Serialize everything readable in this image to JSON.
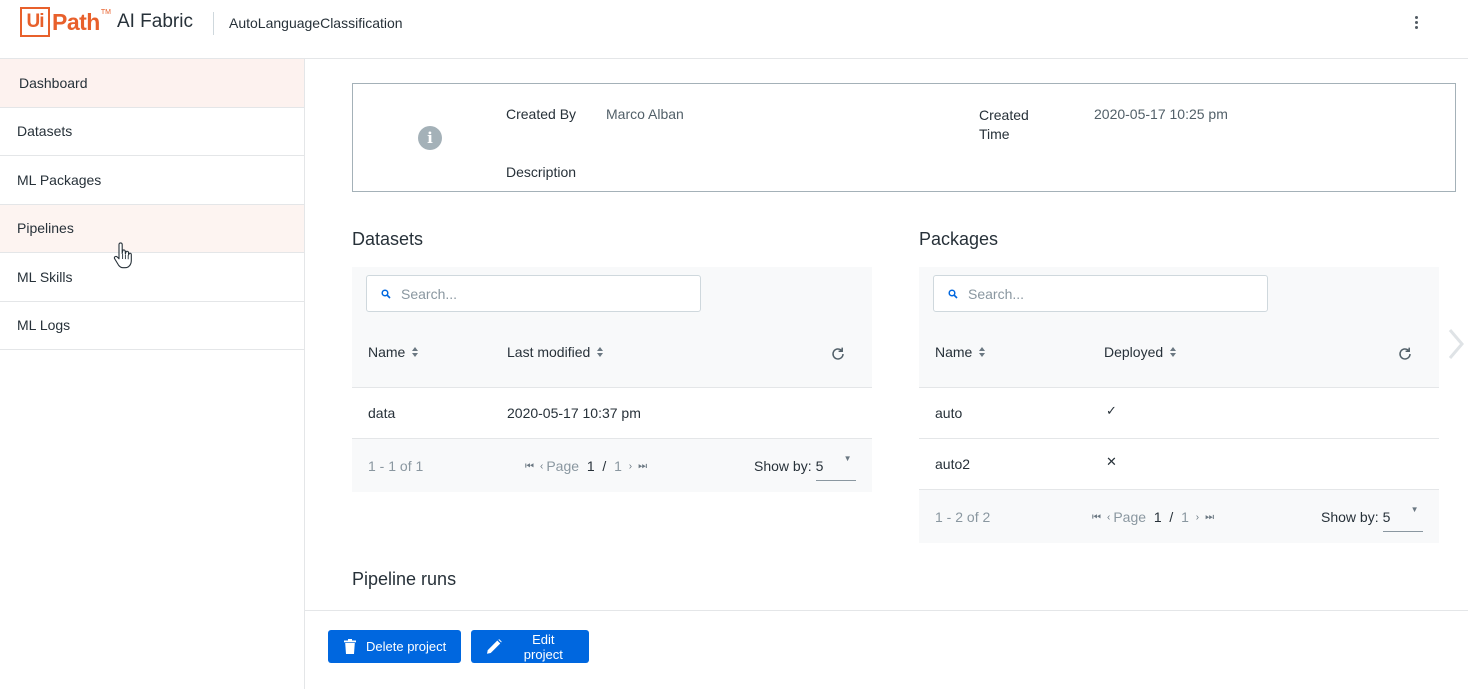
{
  "header": {
    "logo_ui": "Ui",
    "logo_path": "Path",
    "logo_tm": "TM",
    "product": "AI Fabric",
    "project_name": "AutoLanguageClassification"
  },
  "sidebar": {
    "items": [
      {
        "label": "Dashboard"
      },
      {
        "label": "Datasets"
      },
      {
        "label": "ML Packages"
      },
      {
        "label": "Pipelines"
      },
      {
        "label": "ML Skills"
      },
      {
        "label": "ML Logs"
      }
    ]
  },
  "info": {
    "created_by_label": "Created By",
    "created_by_value": "Marco Alban",
    "created_time_label": "Created Time",
    "created_time_value": "2020-05-17 10:25 pm",
    "description_label": "Description"
  },
  "datasets": {
    "title": "Datasets",
    "search_placeholder": "Search...",
    "columns": [
      "Name",
      "Last modified"
    ],
    "rows": [
      {
        "name": "data",
        "last_modified": "2020-05-17 10:37 pm"
      }
    ],
    "pager": {
      "count": "1 - 1 of 1",
      "page_label": "Page",
      "page": "1",
      "sep": "/",
      "total": "1",
      "show_by_label": "Show by:",
      "show_by_value": "5"
    }
  },
  "packages": {
    "title": "Packages",
    "search_placeholder": "Search...",
    "columns": [
      "Name",
      "Deployed"
    ],
    "rows": [
      {
        "name": "auto",
        "deployed": "✓"
      },
      {
        "name": "auto2",
        "deployed": "✕"
      }
    ],
    "pager": {
      "count": "1 - 2 of 2",
      "page_label": "Page",
      "page": "1",
      "sep": "/",
      "total": "1",
      "show_by_label": "Show by:",
      "show_by_value": "5"
    }
  },
  "pipeline_runs": {
    "title": "Pipeline runs"
  },
  "footer": {
    "delete_label": "Delete project",
    "edit_label": "Edit project"
  },
  "colors": {
    "brand": "#e8602b",
    "primary": "#0067df"
  }
}
